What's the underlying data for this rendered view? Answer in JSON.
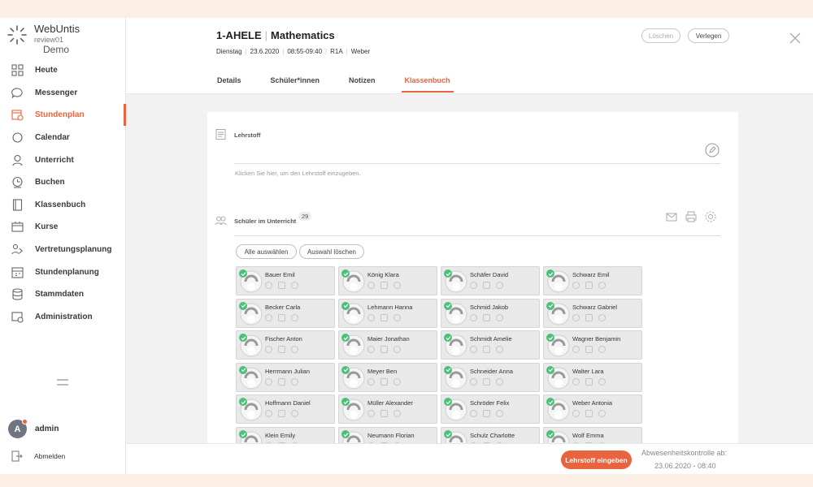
{
  "brand": {
    "name": "WebUntis",
    "sub": "review01",
    "sub2": "Demo"
  },
  "nav": [
    {
      "label": "Heute",
      "icon": "dashboard-icon"
    },
    {
      "label": "Messenger",
      "icon": "chat-bubble-icon"
    },
    {
      "label": "Stundenplan",
      "icon": "calendar-clock-icon",
      "active": true
    },
    {
      "label": "Calendar",
      "icon": "circle-icon"
    },
    {
      "label": "Unterricht",
      "icon": "lesson-icon"
    },
    {
      "label": "Buchen",
      "icon": "booking-icon"
    },
    {
      "label": "Klassenbuch",
      "icon": "book-icon"
    },
    {
      "label": "Kurse",
      "icon": "courses-icon"
    },
    {
      "label": "Vertretungsplanung",
      "icon": "substitution-icon"
    },
    {
      "label": "Stundenplanung",
      "icon": "planning-icon"
    },
    {
      "label": "Stammdaten",
      "icon": "database-icon"
    },
    {
      "label": "Administration",
      "icon": "admin-icon"
    }
  ],
  "user": {
    "initial": "A",
    "name": "admin"
  },
  "logout_label": "Abmelden",
  "header": {
    "class": "1-AHELE",
    "subject": "Mathematics",
    "meta": [
      "Dienstag",
      "23.6.2020",
      "08:55-09:40",
      "R1A",
      "Weber"
    ],
    "delete_label": "Löschen",
    "move_label": "Verlegen"
  },
  "tabs": [
    {
      "label": "Details"
    },
    {
      "label": "Schüler*innen"
    },
    {
      "label": "Notizen"
    },
    {
      "label": "Klassenbuch",
      "active": true
    }
  ],
  "lehrstoff": {
    "label": "Lehrstoff",
    "placeholder": "Klicken Sie hier, um den Lehrstoff einzugeben."
  },
  "students_section": {
    "label": "Schüler im Unterricht",
    "count": "29",
    "select_all": "Alle auswählen",
    "clear_selection": "Auswahl löschen"
  },
  "students": [
    [
      "Bauer Emil",
      "König Klara",
      "Schäfer David",
      "Schwarz Emil"
    ],
    [
      "Becker Carla",
      "Lehmann Hanna",
      "Schmid Jakob",
      "Schwarz Gabriel"
    ],
    [
      "Fischer Anton",
      "Maier Jonathan",
      "Schmidt Amelie",
      "Wagner Benjamin"
    ],
    [
      "Herrmann Julian",
      "Meyer Ben",
      "Schneider Anna",
      "Walter Lara"
    ],
    [
      "Hoffmann Daniel",
      "Müller Alexander",
      "Schröder Felix",
      "Weber Antonia"
    ],
    [
      "Klein Emily",
      "Neumann Florian",
      "Schulz Charlotte",
      "Wolf Emma"
    ]
  ],
  "footer": {
    "cta": "Lehrstoff eingeben",
    "absence_label": "Abwesenheitskontrolle ab:",
    "absence_time": "23.06.2020 - 08:40"
  },
  "colors": {
    "accent": "#e8643f",
    "present": "#4cc07a"
  }
}
